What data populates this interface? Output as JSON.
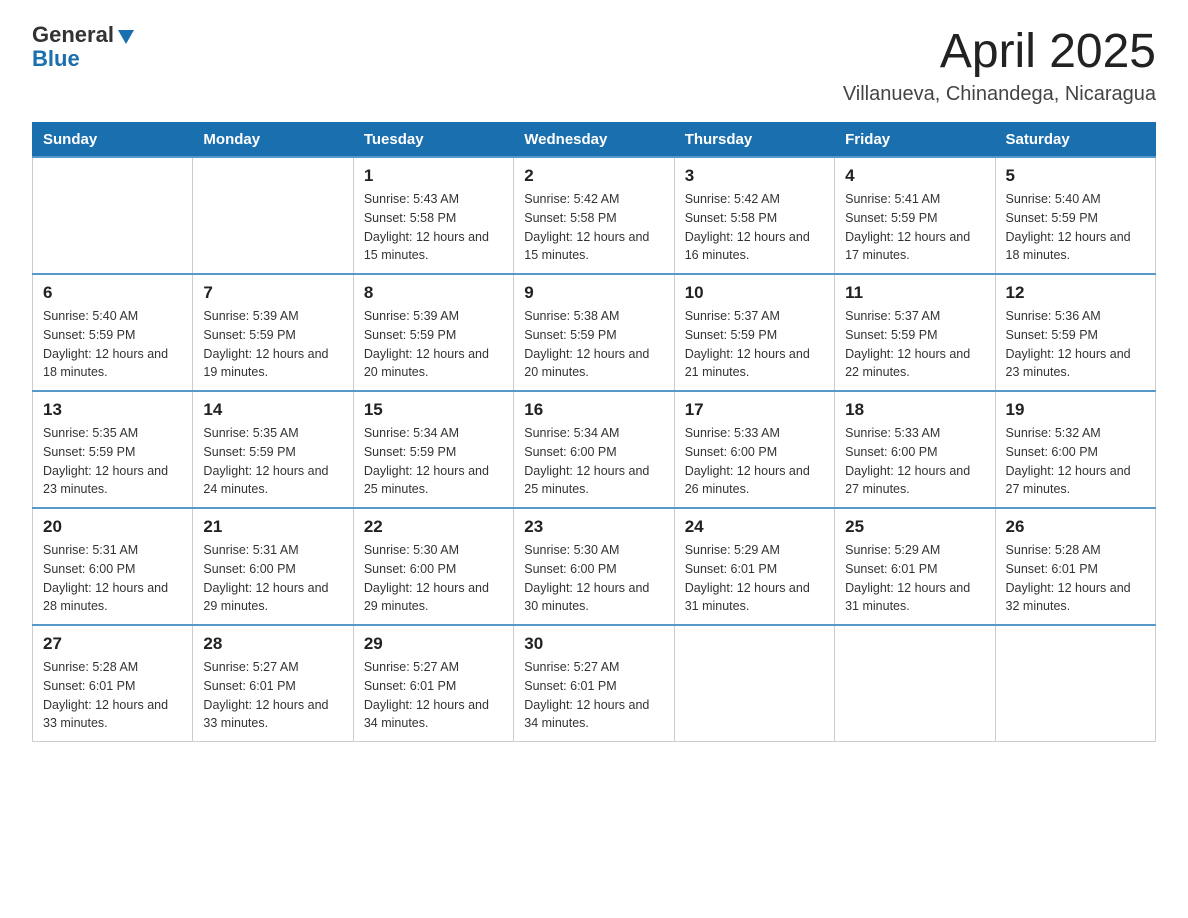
{
  "header": {
    "logo_general": "General",
    "logo_blue": "Blue",
    "title": "April 2025",
    "subtitle": "Villanueva, Chinandega, Nicaragua"
  },
  "days_of_week": [
    "Sunday",
    "Monday",
    "Tuesday",
    "Wednesday",
    "Thursday",
    "Friday",
    "Saturday"
  ],
  "weeks": [
    [
      {
        "day": "",
        "sunrise": "",
        "sunset": "",
        "daylight": ""
      },
      {
        "day": "",
        "sunrise": "",
        "sunset": "",
        "daylight": ""
      },
      {
        "day": "1",
        "sunrise": "Sunrise: 5:43 AM",
        "sunset": "Sunset: 5:58 PM",
        "daylight": "Daylight: 12 hours and 15 minutes."
      },
      {
        "day": "2",
        "sunrise": "Sunrise: 5:42 AM",
        "sunset": "Sunset: 5:58 PM",
        "daylight": "Daylight: 12 hours and 15 minutes."
      },
      {
        "day": "3",
        "sunrise": "Sunrise: 5:42 AM",
        "sunset": "Sunset: 5:58 PM",
        "daylight": "Daylight: 12 hours and 16 minutes."
      },
      {
        "day": "4",
        "sunrise": "Sunrise: 5:41 AM",
        "sunset": "Sunset: 5:59 PM",
        "daylight": "Daylight: 12 hours and 17 minutes."
      },
      {
        "day": "5",
        "sunrise": "Sunrise: 5:40 AM",
        "sunset": "Sunset: 5:59 PM",
        "daylight": "Daylight: 12 hours and 18 minutes."
      }
    ],
    [
      {
        "day": "6",
        "sunrise": "Sunrise: 5:40 AM",
        "sunset": "Sunset: 5:59 PM",
        "daylight": "Daylight: 12 hours and 18 minutes."
      },
      {
        "day": "7",
        "sunrise": "Sunrise: 5:39 AM",
        "sunset": "Sunset: 5:59 PM",
        "daylight": "Daylight: 12 hours and 19 minutes."
      },
      {
        "day": "8",
        "sunrise": "Sunrise: 5:39 AM",
        "sunset": "Sunset: 5:59 PM",
        "daylight": "Daylight: 12 hours and 20 minutes."
      },
      {
        "day": "9",
        "sunrise": "Sunrise: 5:38 AM",
        "sunset": "Sunset: 5:59 PM",
        "daylight": "Daylight: 12 hours and 20 minutes."
      },
      {
        "day": "10",
        "sunrise": "Sunrise: 5:37 AM",
        "sunset": "Sunset: 5:59 PM",
        "daylight": "Daylight: 12 hours and 21 minutes."
      },
      {
        "day": "11",
        "sunrise": "Sunrise: 5:37 AM",
        "sunset": "Sunset: 5:59 PM",
        "daylight": "Daylight: 12 hours and 22 minutes."
      },
      {
        "day": "12",
        "sunrise": "Sunrise: 5:36 AM",
        "sunset": "Sunset: 5:59 PM",
        "daylight": "Daylight: 12 hours and 23 minutes."
      }
    ],
    [
      {
        "day": "13",
        "sunrise": "Sunrise: 5:35 AM",
        "sunset": "Sunset: 5:59 PM",
        "daylight": "Daylight: 12 hours and 23 minutes."
      },
      {
        "day": "14",
        "sunrise": "Sunrise: 5:35 AM",
        "sunset": "Sunset: 5:59 PM",
        "daylight": "Daylight: 12 hours and 24 minutes."
      },
      {
        "day": "15",
        "sunrise": "Sunrise: 5:34 AM",
        "sunset": "Sunset: 5:59 PM",
        "daylight": "Daylight: 12 hours and 25 minutes."
      },
      {
        "day": "16",
        "sunrise": "Sunrise: 5:34 AM",
        "sunset": "Sunset: 6:00 PM",
        "daylight": "Daylight: 12 hours and 25 minutes."
      },
      {
        "day": "17",
        "sunrise": "Sunrise: 5:33 AM",
        "sunset": "Sunset: 6:00 PM",
        "daylight": "Daylight: 12 hours and 26 minutes."
      },
      {
        "day": "18",
        "sunrise": "Sunrise: 5:33 AM",
        "sunset": "Sunset: 6:00 PM",
        "daylight": "Daylight: 12 hours and 27 minutes."
      },
      {
        "day": "19",
        "sunrise": "Sunrise: 5:32 AM",
        "sunset": "Sunset: 6:00 PM",
        "daylight": "Daylight: 12 hours and 27 minutes."
      }
    ],
    [
      {
        "day": "20",
        "sunrise": "Sunrise: 5:31 AM",
        "sunset": "Sunset: 6:00 PM",
        "daylight": "Daylight: 12 hours and 28 minutes."
      },
      {
        "day": "21",
        "sunrise": "Sunrise: 5:31 AM",
        "sunset": "Sunset: 6:00 PM",
        "daylight": "Daylight: 12 hours and 29 minutes."
      },
      {
        "day": "22",
        "sunrise": "Sunrise: 5:30 AM",
        "sunset": "Sunset: 6:00 PM",
        "daylight": "Daylight: 12 hours and 29 minutes."
      },
      {
        "day": "23",
        "sunrise": "Sunrise: 5:30 AM",
        "sunset": "Sunset: 6:00 PM",
        "daylight": "Daylight: 12 hours and 30 minutes."
      },
      {
        "day": "24",
        "sunrise": "Sunrise: 5:29 AM",
        "sunset": "Sunset: 6:01 PM",
        "daylight": "Daylight: 12 hours and 31 minutes."
      },
      {
        "day": "25",
        "sunrise": "Sunrise: 5:29 AM",
        "sunset": "Sunset: 6:01 PM",
        "daylight": "Daylight: 12 hours and 31 minutes."
      },
      {
        "day": "26",
        "sunrise": "Sunrise: 5:28 AM",
        "sunset": "Sunset: 6:01 PM",
        "daylight": "Daylight: 12 hours and 32 minutes."
      }
    ],
    [
      {
        "day": "27",
        "sunrise": "Sunrise: 5:28 AM",
        "sunset": "Sunset: 6:01 PM",
        "daylight": "Daylight: 12 hours and 33 minutes."
      },
      {
        "day": "28",
        "sunrise": "Sunrise: 5:27 AM",
        "sunset": "Sunset: 6:01 PM",
        "daylight": "Daylight: 12 hours and 33 minutes."
      },
      {
        "day": "29",
        "sunrise": "Sunrise: 5:27 AM",
        "sunset": "Sunset: 6:01 PM",
        "daylight": "Daylight: 12 hours and 34 minutes."
      },
      {
        "day": "30",
        "sunrise": "Sunrise: 5:27 AM",
        "sunset": "Sunset: 6:01 PM",
        "daylight": "Daylight: 12 hours and 34 minutes."
      },
      {
        "day": "",
        "sunrise": "",
        "sunset": "",
        "daylight": ""
      },
      {
        "day": "",
        "sunrise": "",
        "sunset": "",
        "daylight": ""
      },
      {
        "day": "",
        "sunrise": "",
        "sunset": "",
        "daylight": ""
      }
    ]
  ]
}
